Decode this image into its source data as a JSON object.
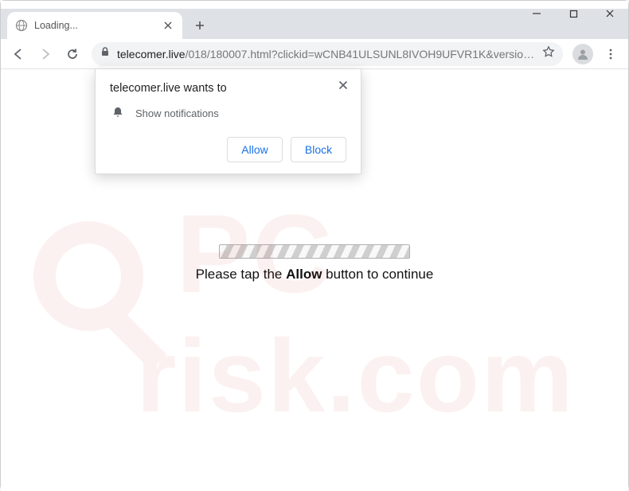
{
  "window": {
    "controls": {
      "minimize": "min",
      "maximize": "max",
      "close": "close"
    }
  },
  "tab": {
    "title": "Loading...",
    "close": "×",
    "new_tab": "+"
  },
  "toolbar": {
    "back": "back",
    "forward": "fwd",
    "reload": "reload",
    "star": "star",
    "menu": "menu"
  },
  "url": {
    "host": "telecomer.live",
    "path": "/018/180007.html?clickid=wCNB41ULSUNL8IVOH9UFVR1K&version=…"
  },
  "permission": {
    "title": "telecomer.live wants to",
    "item": "Show notifications",
    "allow": "Allow",
    "block": "Block"
  },
  "page": {
    "text_pre": "Please tap the ",
    "text_bold": "Allow",
    "text_post": " button to continue"
  },
  "watermark": {
    "text": "pcrisk.com"
  }
}
